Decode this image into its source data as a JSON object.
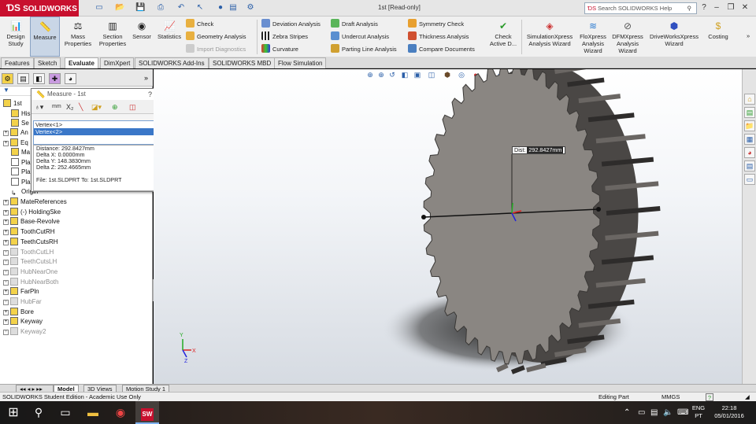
{
  "titlebar": {
    "app_name": "SOLIDWORKS",
    "document_title": "1st [Read-only]",
    "search_placeholder": "Search SOLIDWORKS Help"
  },
  "command_manager": {
    "large_buttons": [
      "Design Study",
      "Measure",
      "Mass Properties",
      "Section Properties",
      "Sensor",
      "Statistics"
    ],
    "col1": [
      "Check",
      "Geometry Analysis",
      "Import Diagnostics"
    ],
    "col2": [
      "Deviation Analysis",
      "Zebra Stripes",
      "Curvature"
    ],
    "col3": [
      "Draft Analysis",
      "Undercut Analysis",
      "Parting Line Analysis"
    ],
    "col4": [
      "Symmetry Check",
      "Thickness Analysis",
      "Compare Documents"
    ],
    "check_active_doc": "Check Active D...",
    "right_buttons": [
      "SimulationXpress Analysis Wizard",
      "FloXpress Analysis Wizard",
      "DFMXpress Analysis Wizard",
      "DriveWorksXpress Wizard",
      "Costing"
    ]
  },
  "tabs": [
    "Features",
    "Sketch",
    "Evaluate",
    "DimXpert",
    "SOLIDWORKS Add-Ins",
    "SOLIDWORKS MBD",
    "Flow Simulation"
  ],
  "active_tab": "Evaluate",
  "feature_tree": {
    "root": "1st",
    "partially_hidden": [
      "His",
      "Se",
      "An",
      "Eq",
      "Ma",
      "Pla",
      "Pla",
      "Pla"
    ],
    "origin": "Origin",
    "items": [
      {
        "label": "MateReferences",
        "grey": false
      },
      {
        "label": "(-) HoldingSke",
        "grey": false
      },
      {
        "label": "Base-Revolve",
        "grey": false
      },
      {
        "label": "ToothCutRH",
        "grey": false
      },
      {
        "label": "TeethCutsRH",
        "grey": false
      },
      {
        "label": "ToothCutLH",
        "grey": true
      },
      {
        "label": "TeethCutsLH",
        "grey": true
      },
      {
        "label": "HubNearOne",
        "grey": true
      },
      {
        "label": "HubNearBoth",
        "grey": true
      },
      {
        "label": "FarPln",
        "grey": false
      },
      {
        "label": "HubFar",
        "grey": true
      },
      {
        "label": "Bore",
        "grey": false
      },
      {
        "label": "Keyway",
        "grey": false
      },
      {
        "label": "Keyway2",
        "grey": true
      }
    ]
  },
  "measure_dialog": {
    "title": "Measure - 1st",
    "help": "?",
    "close": "×",
    "selections": [
      "Vertex<1>",
      "Vertex<2>"
    ],
    "results": [
      "Distance: 292.8427mm",
      "Delta X: 0.0000mm",
      "Delta Y: 148.3830mm",
      "Delta Z: 252.4665mm",
      "",
      "File: 1st.SLDPRT To: 1st.SLDPRT"
    ]
  },
  "viewport": {
    "dist_prefix": "Dist:",
    "dist_value": "292.8427mm",
    "triad_labels": {
      "x": "X",
      "y": "Y",
      "z": "Z"
    }
  },
  "bottom_tabs": [
    "Model",
    "3D Views",
    "Motion Study 1"
  ],
  "statusbar": {
    "left": "SOLIDWORKS Student Edition - Academic Use Only",
    "mode": "Editing Part",
    "units": "MMGS",
    "help": "?"
  },
  "taskbar": {
    "lang_top": "ENG",
    "lang_bottom": "PT",
    "time": "22:18",
    "date": "05/01/2016"
  },
  "colors": {
    "brand": "#c8102e",
    "gear_face": "#8a8682",
    "gear_teeth": "#4a4745",
    "selection": "#3a77c8"
  }
}
